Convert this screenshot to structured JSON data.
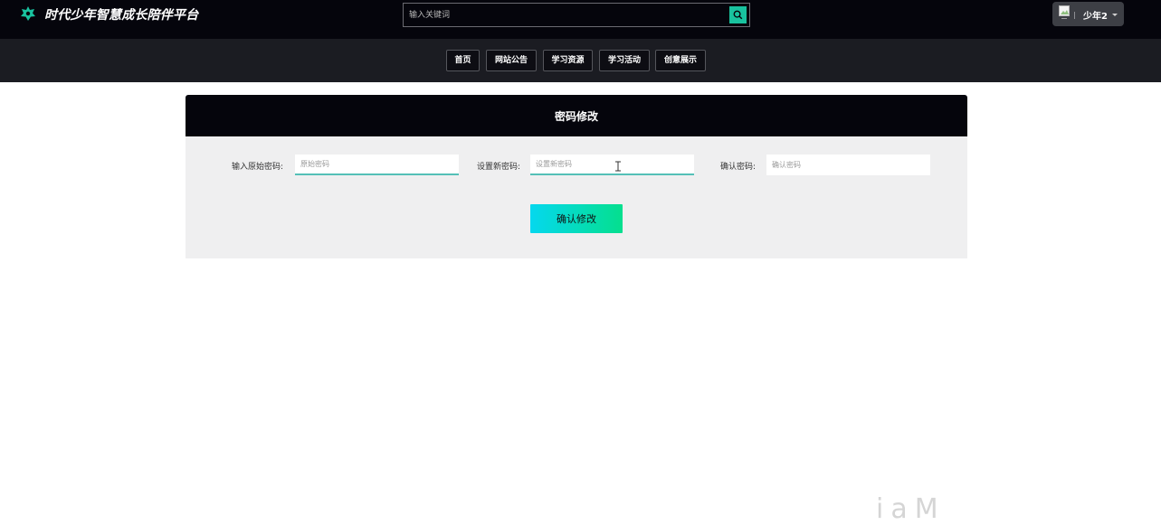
{
  "header": {
    "brand": "时代少年智慧成长陪伴平台",
    "logo_icon": "flower-logo-icon",
    "brand_color": "#19c29f",
    "search": {
      "placeholder": "输入关键词",
      "button_icon": "search-icon"
    },
    "user": {
      "name": "少年2",
      "avatar_icon": "avatar-icon",
      "menu_icon": "caret-down-icon"
    }
  },
  "nav": {
    "items": [
      {
        "label": "首页"
      },
      {
        "label": "网站公告"
      },
      {
        "label": "学习资源"
      },
      {
        "label": "学习活动"
      },
      {
        "label": "创意展示"
      }
    ]
  },
  "form": {
    "title": "密码修改",
    "fields": [
      {
        "label": "输入原始密码:",
        "placeholder": "原始密码",
        "value": ""
      },
      {
        "label": "设置新密码:",
        "placeholder": "设置新密码",
        "value": ""
      },
      {
        "label": "确认密码:",
        "placeholder": "确认密码",
        "value": ""
      }
    ],
    "submit_label": "确认修改",
    "accent_gradient": [
      "#05d8ee",
      "#05df8e"
    ]
  },
  "watermark": "iaM"
}
